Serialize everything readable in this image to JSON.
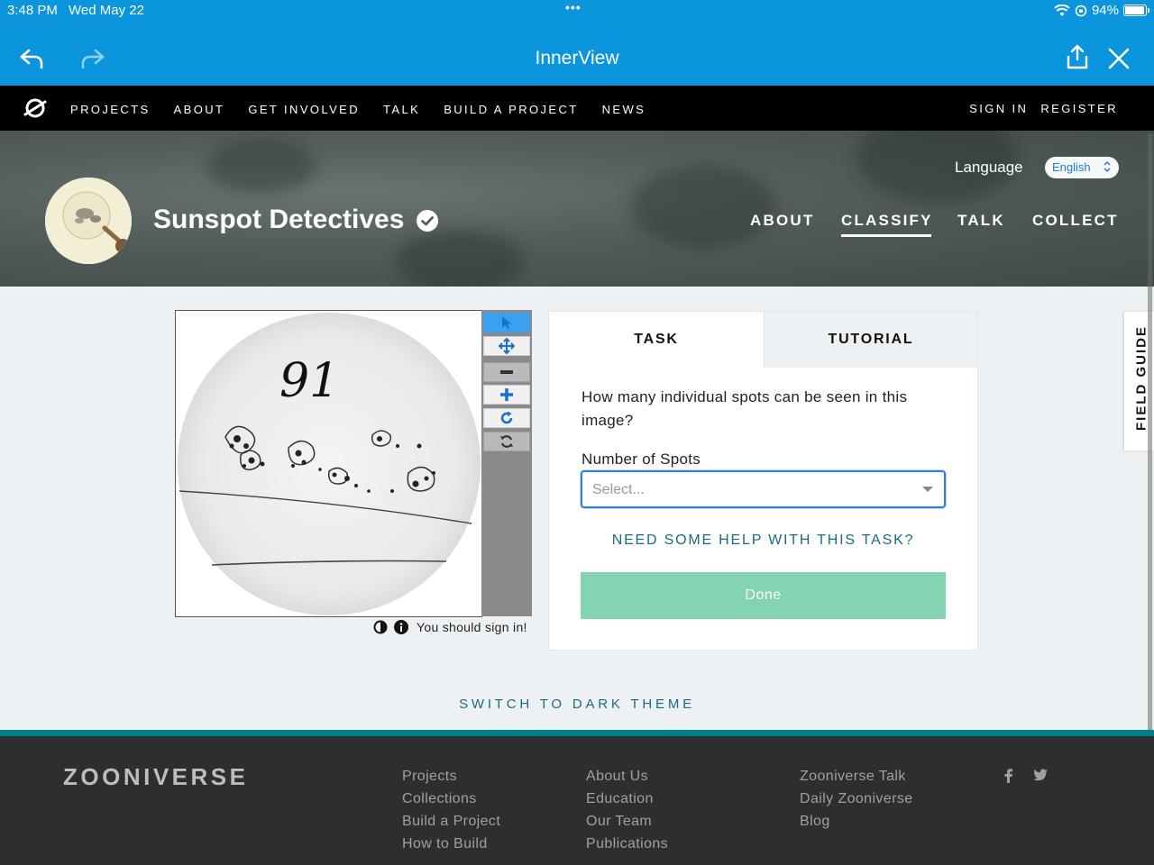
{
  "status_bar": {
    "time": "3:48 PM",
    "date": "Wed May 22",
    "dots": "•••",
    "battery": "94%",
    "battery_level": 0.94
  },
  "browser": {
    "title": "InnerView",
    "icons": [
      "back-arrow-icon",
      "forward-arrow-icon",
      "share-icon",
      "close-icon"
    ]
  },
  "site_nav": {
    "links": [
      "PROJECTS",
      "ABOUT",
      "GET INVOLVED",
      "TALK",
      "BUILD A PROJECT",
      "NEWS"
    ],
    "sign_in": "SIGN IN",
    "register": "REGISTER"
  },
  "project": {
    "title": "Sunspot Detectives",
    "language_label": "Language",
    "language_value": "English",
    "tabs": [
      "ABOUT",
      "CLASSIFY",
      "TALK",
      "COLLECT"
    ],
    "active_tab": "CLASSIFY"
  },
  "viewer": {
    "handwritten_number": "91",
    "sign_in_note": "You should sign in!",
    "tools": [
      "pointer-icon",
      "pan-icon",
      "zoom-out-icon",
      "zoom-in-icon",
      "rotate-icon",
      "reset-icon"
    ]
  },
  "task": {
    "tab_task": "TASK",
    "tab_tutorial": "TUTORIAL",
    "question": "How many individual spots can be seen in this image?",
    "select_label": "Number of Spots",
    "select_placeholder": "Select...",
    "help": "NEED SOME HELP WITH THIS TASK?",
    "done": "Done"
  },
  "field_guide": "FIELD GUIDE",
  "dark_theme": "SWITCH TO DARK THEME",
  "footer": {
    "logo": "ZOONIVERSE",
    "col1": [
      "Projects",
      "Collections",
      "Build a Project",
      "How to Build"
    ],
    "col2": [
      "About Us",
      "Education",
      "Our Team",
      "Publications"
    ],
    "col3": [
      "Zooniverse Talk",
      "Daily Zooniverse",
      "Blog"
    ]
  },
  "colors": {
    "brand_blue": "#0a95dc",
    "teal": "#00808a",
    "done_green": "#84d3b3"
  }
}
